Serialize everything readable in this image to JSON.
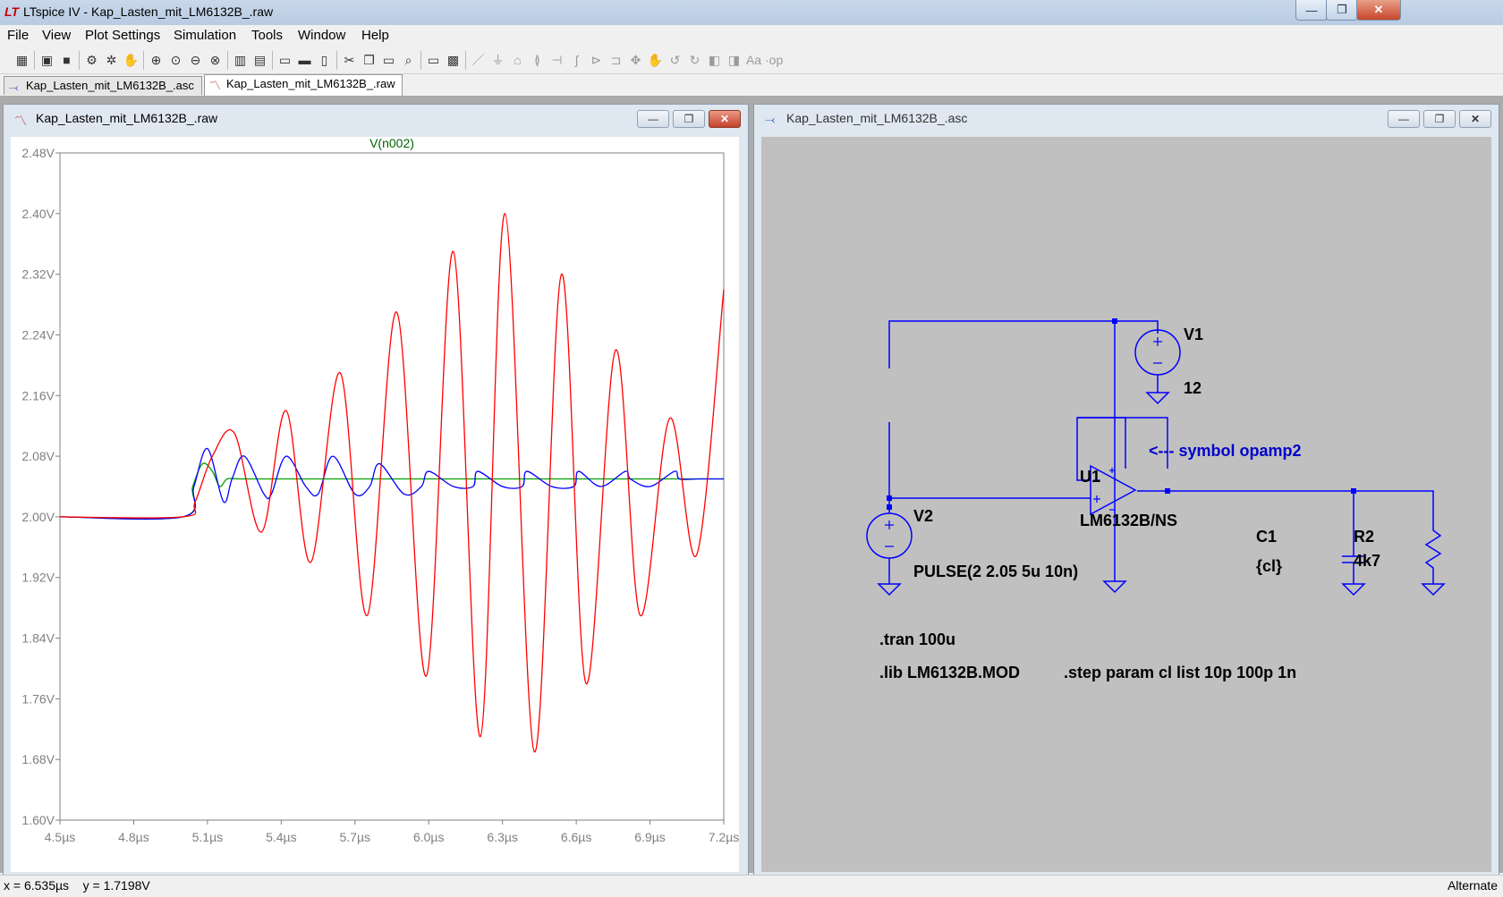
{
  "app": {
    "title": "LTspice IV - Kap_Lasten_mit_LM6132B_.raw",
    "window_buttons": {
      "minimize": "—",
      "restore": "❐",
      "close": "✕"
    }
  },
  "menu": [
    "File",
    "View",
    "Plot Settings",
    "Simulation",
    "Tools",
    "Window",
    "Help"
  ],
  "toolbar": {
    "icons": [
      "new-schematic-icon",
      "open-icon",
      "save-icon",
      "control-panel-icon",
      "run-icon",
      "halt-icon",
      "zoom-in-icon",
      "zoom-back-icon",
      "zoom-out-icon",
      "zoom-extents-icon",
      "autorange-icon",
      "add-trace-icon",
      "tile-horizontal-icon",
      "cascade-icon",
      "tile-vertical-icon",
      "cut-icon",
      "copy-icon",
      "paste-icon",
      "find-icon",
      "print-setup-icon",
      "print-icon",
      "wire-icon",
      "ground-icon",
      "label-icon",
      "resistor-icon",
      "capacitor-icon",
      "inductor-icon",
      "diode-icon",
      "component-icon",
      "move-icon",
      "drag-icon",
      "undo-icon",
      "redo-icon",
      "rotate-icon",
      "mirror-icon",
      "text-icon",
      "spice-directive-icon"
    ],
    "glyphs": [
      "▦",
      "▣",
      "■",
      "⚙",
      "✲",
      "✋",
      "⊕",
      "⊙",
      "⊖",
      "⊗",
      "▥",
      "▤",
      "▭",
      "▬",
      "▯",
      "✂",
      "❐",
      "▭",
      "⌕",
      "▭",
      "▩",
      "／",
      "⏚",
      "⌂",
      "≬",
      "⊣",
      "ʃ",
      "⊳",
      "⊐",
      "✥",
      "✋",
      "↺",
      "↻",
      "◧",
      "◨",
      "Aa",
      "·op"
    ],
    "dim_from": 21
  },
  "tabs": [
    {
      "label": "Kap_Lasten_mit_LM6132B_.asc",
      "icon": "schematic-icon",
      "active": false
    },
    {
      "label": "Kap_Lasten_mit_LM6132B_.raw",
      "icon": "waveform-icon",
      "active": true
    }
  ],
  "plot_window": {
    "title": "Kap_Lasten_mit_LM6132B_.raw",
    "trace_label": "V(n002)",
    "trace_label_color": "#006400"
  },
  "schematic_window": {
    "title": "Kap_Lasten_mit_LM6132B_.asc",
    "labels": {
      "v1_name": "V1",
      "v1_value": "12",
      "v2_name": "V2",
      "v2_value": "PULSE(2 2.05 5u 10n)",
      "u1_name": "U1",
      "u1_value": "LM6132B/NS",
      "c1_name": "C1",
      "c1_value": "{cl}",
      "r2_name": "R2",
      "r2_value": "4k7",
      "comment": "<--- symbol opamp2",
      "directive_tran": ".tran 100u",
      "directive_lib": ".lib LM6132B.MOD",
      "directive_step": ".step param cl list 10p 100p 1n"
    },
    "colors": {
      "background": "#c0c0c0",
      "wire": "#0000ff",
      "text": "#000000",
      "comment": "#0000cc"
    }
  },
  "statusbar": {
    "cursor": "x = 6.535µs    y = 1.7198V",
    "mode": "Alternate"
  },
  "chart_data": {
    "type": "line",
    "title": "V(n002)",
    "xlabel": "",
    "ylabel": "",
    "xlim": [
      4.5,
      7.2
    ],
    "ylim": [
      1.6,
      2.48
    ],
    "x_unit": "µs",
    "y_unit": "V",
    "x_ticks": [
      "4.5µs",
      "4.8µs",
      "5.1µs",
      "5.4µs",
      "5.7µs",
      "6.0µs",
      "6.3µs",
      "6.6µs",
      "6.9µs",
      "7.2µs"
    ],
    "y_ticks": [
      "2.48V",
      "2.40V",
      "2.32V",
      "2.24V",
      "2.16V",
      "2.08V",
      "2.00V",
      "1.92V",
      "1.84V",
      "1.76V",
      "1.68V",
      "1.60V"
    ],
    "grid": false,
    "colors": {
      "axis": "#808080",
      "background": "#ffffff"
    },
    "series": [
      {
        "color": "#00a000",
        "x": [
          4.5,
          5.0,
          5.04,
          5.08,
          5.12,
          5.15,
          5.18,
          5.23,
          5.3,
          5.5,
          7.2
        ],
        "y": [
          2.0,
          2.0,
          2.04,
          2.07,
          2.06,
          2.04,
          2.05,
          2.05,
          2.05,
          2.05,
          2.05
        ]
      },
      {
        "color": "#0000ff",
        "x": [
          4.5,
          5.0,
          5.045,
          5.1,
          5.165,
          5.2,
          5.25,
          5.33,
          5.36,
          5.42,
          5.5,
          5.55,
          5.61,
          5.7,
          5.76,
          5.8,
          5.9,
          5.97,
          6.0,
          6.1,
          6.18,
          6.2,
          6.3,
          6.38,
          6.4,
          6.5,
          6.59,
          6.61,
          6.7,
          6.8,
          6.82,
          6.9,
          7.0,
          7.02,
          7.1,
          7.2
        ],
        "y": [
          2.0,
          2.0,
          2.04,
          2.09,
          2.02,
          2.05,
          2.08,
          2.03,
          2.03,
          2.08,
          2.04,
          2.03,
          2.08,
          2.03,
          2.04,
          2.07,
          2.03,
          2.04,
          2.06,
          2.04,
          2.04,
          2.06,
          2.04,
          2.04,
          2.06,
          2.04,
          2.04,
          2.06,
          2.04,
          2.06,
          2.05,
          2.04,
          2.06,
          2.05,
          2.05,
          2.05
        ]
      },
      {
        "color": "#ff0000",
        "x": [
          4.5,
          5.0,
          5.05,
          5.12,
          5.21,
          5.32,
          5.42,
          5.52,
          5.64,
          5.75,
          5.87,
          5.99,
          6.1,
          6.21,
          6.31,
          6.43,
          6.54,
          6.64,
          6.76,
          6.86,
          6.98,
          7.09,
          7.2
        ],
        "y": [
          2.0,
          2.0,
          2.02,
          2.08,
          2.11,
          1.98,
          2.14,
          1.94,
          2.19,
          1.87,
          2.27,
          1.79,
          2.35,
          1.71,
          2.4,
          1.69,
          2.32,
          1.78,
          2.22,
          1.87,
          2.13,
          1.95,
          2.3
        ]
      }
    ]
  }
}
